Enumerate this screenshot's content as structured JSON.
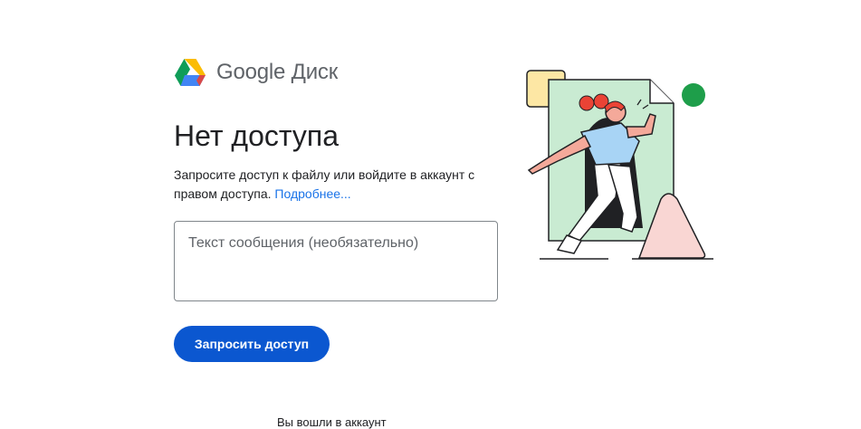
{
  "brand": {
    "product_name": "Google Диск",
    "logo_icon": "google-drive-logo",
    "colors": {
      "green": "#0f9d58",
      "blue": "#4285f4",
      "yellow": "#fbbc04",
      "red": "#ea4335"
    }
  },
  "main": {
    "title": "Нет доступа",
    "description": "Запросите доступ к файлу или войдите в аккаунт с правом доступа.",
    "learn_more_link": "Подробнее...",
    "message_placeholder": "Текст сообщения (необязательно)",
    "request_button_label": "Запросить доступ",
    "accent_color": "#0b57d0"
  },
  "footer": {
    "signed_in_text": "Вы вошли в аккаунт"
  },
  "illustration": {
    "icon": "person-stepping-through-document-illustration"
  }
}
